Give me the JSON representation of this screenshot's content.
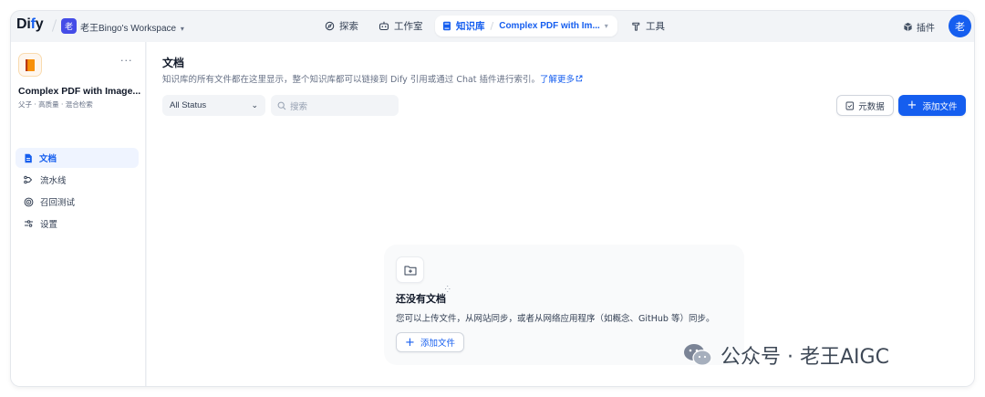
{
  "header": {
    "logo_main": "Di",
    "logo_accent": "f",
    "logo_end": "y",
    "workspace_avatar": "老",
    "workspace_name": "老王Bingo's Workspace",
    "nav": [
      {
        "label": "探索",
        "icon": "compass-icon"
      },
      {
        "label": "工作室",
        "icon": "robot-icon"
      },
      {
        "label": "知识库",
        "icon": "book-icon"
      },
      {
        "label": "工具",
        "icon": "hammer-icon"
      }
    ],
    "dataset_crumb": "Complex PDF with Im...",
    "plugins": "插件",
    "user_avatar": "老"
  },
  "sidebar": {
    "dataset_title": "Complex PDF with Image...",
    "dataset_meta": "父子 · 高质量 · 混合检索",
    "items": [
      {
        "label": "文档",
        "icon": "document-icon",
        "active": true
      },
      {
        "label": "流水线",
        "icon": "pipeline-icon",
        "active": false
      },
      {
        "label": "召回测试",
        "icon": "target-icon",
        "active": false
      },
      {
        "label": "设置",
        "icon": "settings-icon",
        "active": false
      }
    ]
  },
  "main": {
    "title": "文档",
    "description": "知识库的所有文件都在这里显示，整个知识库都可以链接到 Dify 引用或通过 Chat 插件进行索引。",
    "learn_more": "了解更多",
    "status_filter": "All Status",
    "search_placeholder": "搜索",
    "metadata_button": "元数据",
    "add_file_button": "添加文件"
  },
  "empty_state": {
    "title": "还没有文档",
    "description": "您可以上传文件，从网站同步，或者从网络应用程序（如概念、GitHub 等）同步。",
    "add_button": "添加文件"
  },
  "watermark": {
    "text": "公众号 · 老王AIGC"
  },
  "colors": {
    "accent": "#155eef",
    "background": "#f2f4f7"
  }
}
